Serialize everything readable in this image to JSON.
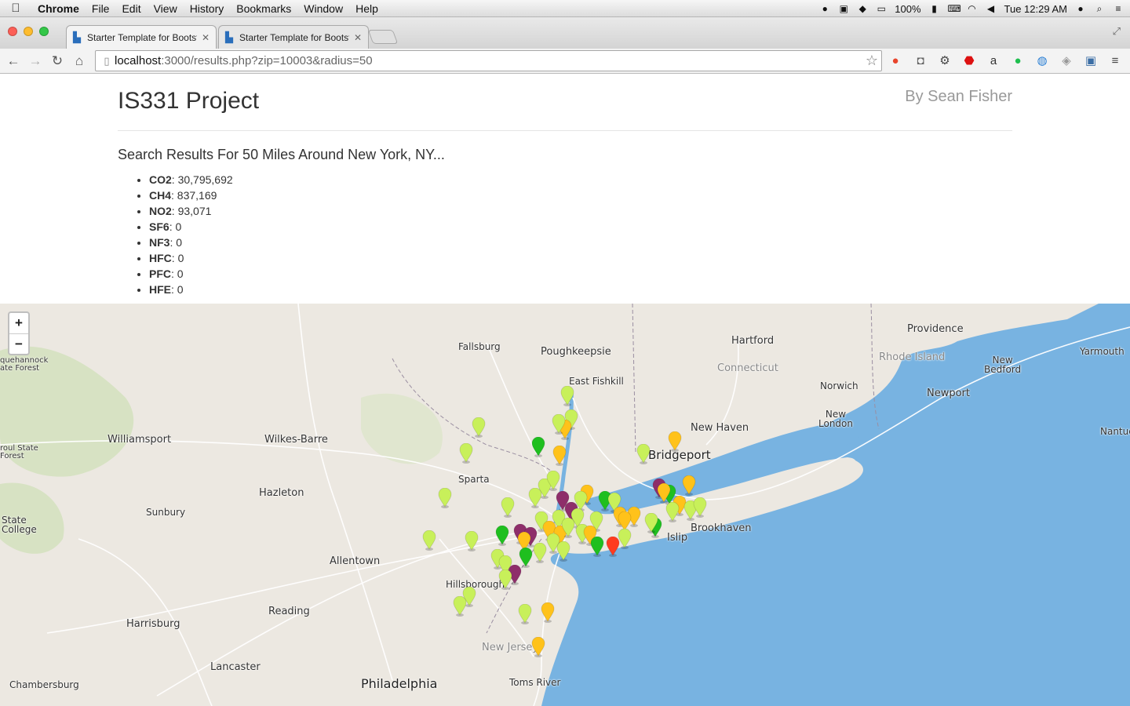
{
  "menubar": {
    "app": "Chrome",
    "items": [
      "File",
      "Edit",
      "View",
      "History",
      "Bookmarks",
      "Window",
      "Help"
    ],
    "battery": "100%",
    "clock": "Tue 12:29 AM"
  },
  "tabs": [
    {
      "title": "Starter Template for Bootst",
      "active": true
    },
    {
      "title": "Starter Template for Bootst",
      "active": false
    }
  ],
  "address": {
    "host": "localhost",
    "path": ":3000/results.php?zip=10003&radius=50"
  },
  "page": {
    "brand": "IS331 Project",
    "byline": "By Sean Fisher",
    "results_title": "Search Results For 50 Miles Around New York, NY...",
    "gases": [
      {
        "name": "CO2",
        "value": "30,795,692"
      },
      {
        "name": "CH4",
        "value": "837,169"
      },
      {
        "name": "NO2",
        "value": "93,071"
      },
      {
        "name": "SF6",
        "value": "0"
      },
      {
        "name": "NF3",
        "value": "0"
      },
      {
        "name": "HFC",
        "value": "0"
      },
      {
        "name": "PFC",
        "value": "0"
      },
      {
        "name": "HFE",
        "value": "0"
      }
    ]
  },
  "map": {
    "zoom_in": "+",
    "zoom_out": "−",
    "labels": {
      "providence": "Providence",
      "hartford": "Hartford",
      "fallsburg": "Fallsburg",
      "poughkeepsie": "Poughkeepsie",
      "rhode_island": "Rhode Island",
      "connecticut": "Connecticut",
      "yarmouth": "Yarmouth",
      "new_bedford": "New\nBedford",
      "east_fishkill": "East Fishkill",
      "norwich": "Norwich",
      "newport": "Newport",
      "new_london": "New\nLondon",
      "new_haven": "New Haven",
      "nantucket": "Nantuc",
      "williamsport": "Williamsport",
      "wilkes_barre": "Wilkes-Barre",
      "bridgeport": "Bridgeport",
      "sparta": "Sparta",
      "hazleton": "Hazleton",
      "sunbury": "Sunbury",
      "islip": "Islip",
      "brookhaven": "Brookhaven",
      "state_college": "State\nCollege",
      "allentown": "Allentown",
      "hillsborough": "Hillsborough",
      "reading": "Reading",
      "harrisburg": "Harrisburg",
      "new_jersey": "New Jersey",
      "lancaster": "Lancaster",
      "philadelphia": "Philadelphia",
      "toms_river": "Toms River",
      "chambersburg": "Chambersburg",
      "tiadaghton": "quehannock\nate Forest",
      "sproul": "roul State\nForest"
    },
    "marker_colors": {
      "lightgreen": "#c8f05a",
      "green": "#1fbf1f",
      "orange": "#ffc21a",
      "purple": "#8e2e6a",
      "red": "#ff3b1f"
    },
    "water_color": "#78b3e1",
    "land_color": "#ece8e1"
  }
}
